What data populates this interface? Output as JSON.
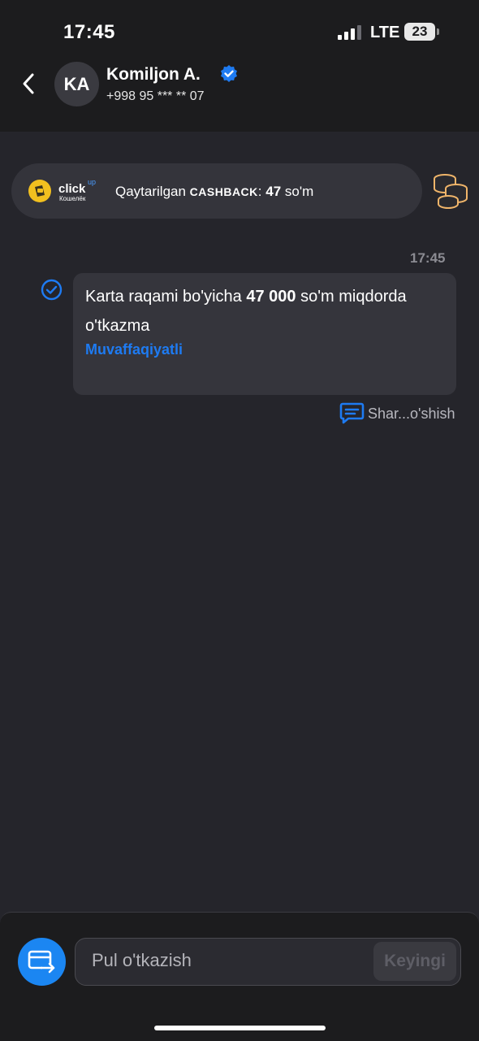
{
  "status_bar": {
    "time": "17:45",
    "network": "LTE",
    "battery": "23"
  },
  "header": {
    "avatar_initials": "KA",
    "name": "Komiljon A.",
    "phone": "+998 95 *** ** 07",
    "icons": {
      "back": "chevron-left-icon",
      "verified": "verified-badge-icon"
    }
  },
  "cashback": {
    "brand": "click",
    "brand_sup": "up",
    "brand_sub": "Кошелёк",
    "label": "Qaytarilgan",
    "label_caps": "CASHBACK",
    "colon": ":",
    "amount": "47",
    "currency": "so'm",
    "icon": "coins-icon"
  },
  "message": {
    "time": "17:45",
    "text_prefix": "Karta raqami bo'yicha ",
    "amount": "47 000",
    "text_suffix": " so'm miqdorda o'tkazma",
    "status": "Muvaffaqiyatli",
    "share_label": "Shar...o'shish"
  },
  "composer": {
    "placeholder": "Pul o'tkazish",
    "next_label": "Keyingi",
    "icon": "card-transfer-icon"
  },
  "colors": {
    "accent": "#1b86f2",
    "background": "#25252b",
    "header": "#1c1c1e",
    "bubble": "#35353c"
  }
}
